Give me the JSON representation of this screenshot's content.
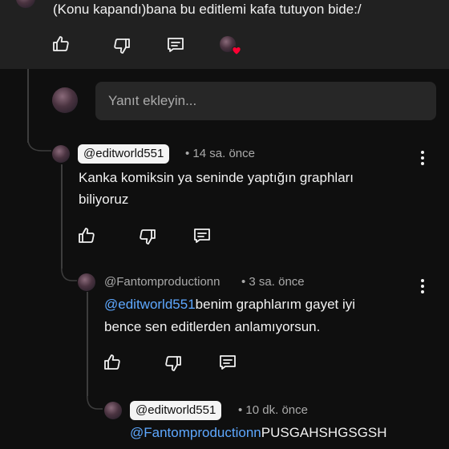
{
  "top_comment": {
    "text": "(Konu kapandı)bana bu editlemi kafa tutuyon bide:/"
  },
  "reply_input": {
    "placeholder": "Yanıt ekleyin..."
  },
  "replies": [
    {
      "author": "@editworld551",
      "time": "• 14 sa. önce",
      "line1": "Kanka komiksin ya seninde yaptığın graphları",
      "line2": "biliyoruz"
    },
    {
      "author": "@Fantomproductionn",
      "time": "• 3 sa. önce",
      "mention": "@editworld551",
      "line1": "benim graphlarım gayet iyi",
      "line2": "bence sen editlerden anlamıyorsun."
    },
    {
      "author": "@editworld551",
      "time": "• 10 dk. önce",
      "mention": "@Fantomproductionn",
      "line1": "PUSGAHSHGSGSH"
    }
  ],
  "colors": {
    "background": "#0f0f0f",
    "card": "#212121",
    "mention": "#5ea8ff",
    "heart": "#ff0033"
  },
  "icons": [
    "like-icon",
    "dislike-icon",
    "reply-icon",
    "heart-icon",
    "more-icon"
  ]
}
